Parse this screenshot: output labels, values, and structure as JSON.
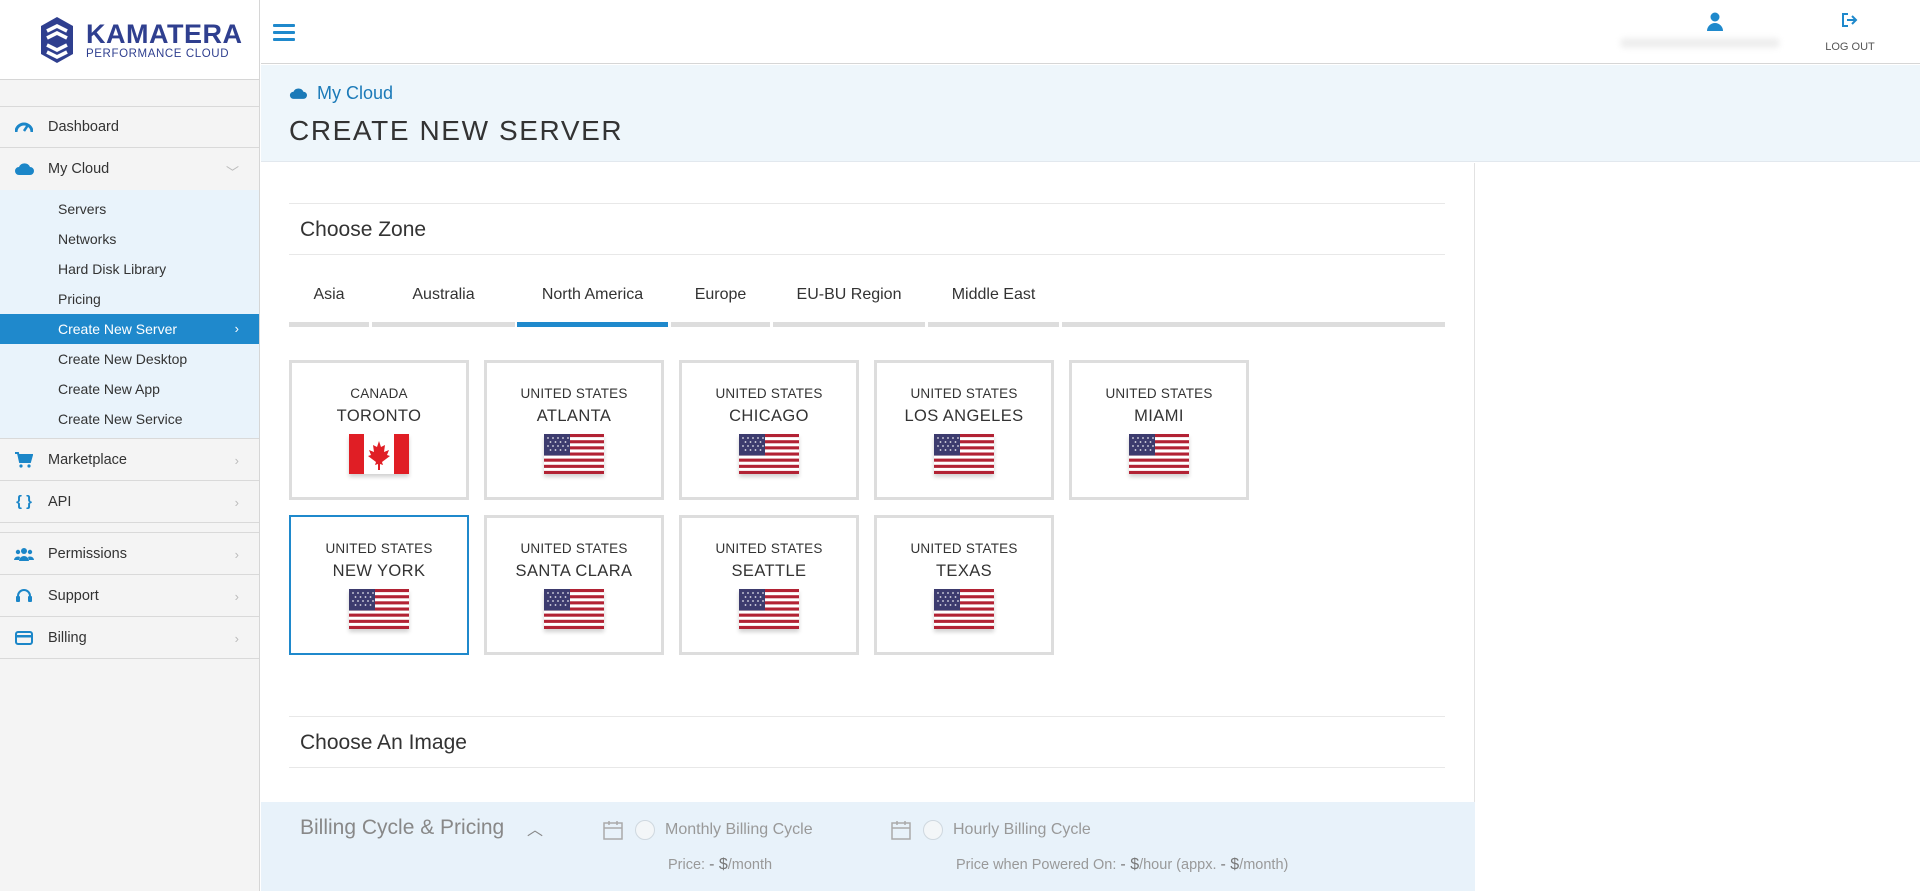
{
  "logo": {
    "brand": "KAMATERA",
    "tagline": "PERFORMANCE CLOUD"
  },
  "topbar": {
    "logout_label": "LOG OUT"
  },
  "sidebar": {
    "items": [
      {
        "label": "Dashboard",
        "icon": "dashboard-icon"
      },
      {
        "label": "My Cloud",
        "icon": "cloud-icon"
      },
      {
        "label": "Marketplace",
        "icon": "cart-icon"
      },
      {
        "label": "API",
        "icon": "braces-icon"
      },
      {
        "label": "Permissions",
        "icon": "users-icon"
      },
      {
        "label": "Support",
        "icon": "headset-icon"
      },
      {
        "label": "Billing",
        "icon": "credit-card-icon"
      }
    ],
    "my_cloud_sub": [
      "Servers",
      "Networks",
      "Hard Disk Library",
      "Pricing",
      "Create New Server",
      "Create New Desktop",
      "Create New App",
      "Create New Service"
    ],
    "active_sub": "Create New Server"
  },
  "header": {
    "breadcrumb": "My Cloud",
    "title": "CREATE NEW SERVER"
  },
  "zone_section": {
    "title": "Choose Zone",
    "tabs": [
      "Asia",
      "Australia",
      "North America",
      "Europe",
      "EU-BU Region",
      "Middle East"
    ],
    "active_tab": "North America",
    "zones": [
      {
        "country": "CANADA",
        "city": "TORONTO",
        "flag": "canada-flag-icon"
      },
      {
        "country": "UNITED STATES",
        "city": "ATLANTA",
        "flag": "us-flag-icon"
      },
      {
        "country": "UNITED STATES",
        "city": "CHICAGO",
        "flag": "us-flag-icon"
      },
      {
        "country": "UNITED STATES",
        "city": "LOS ANGELES",
        "flag": "us-flag-icon"
      },
      {
        "country": "UNITED STATES",
        "city": "MIAMI",
        "flag": "us-flag-icon"
      },
      {
        "country": "UNITED STATES",
        "city": "NEW YORK",
        "flag": "us-flag-icon"
      },
      {
        "country": "UNITED STATES",
        "city": "SANTA CLARA",
        "flag": "us-flag-icon"
      },
      {
        "country": "UNITED STATES",
        "city": "SEATTLE",
        "flag": "us-flag-icon"
      },
      {
        "country": "UNITED STATES",
        "city": "TEXAS",
        "flag": "us-flag-icon"
      }
    ],
    "selected_zone": "NEW YORK"
  },
  "image_section": {
    "title": "Choose An Image"
  },
  "billing": {
    "title": "Billing Cycle & Pricing",
    "monthly": {
      "label": "Monthly Billing Cycle",
      "price_prefix": "Price: ",
      "price_value": "- $",
      "price_suffix": "/month"
    },
    "hourly": {
      "label": "Hourly Billing Cycle",
      "price_prefix": "Price when Powered On: ",
      "price_value": "- $",
      "price_mid": "/hour (appx. ",
      "price_value2": "- $",
      "price_suffix": "/month)"
    }
  },
  "colors": {
    "accent": "#1f89cc",
    "brand": "#2f3f8f",
    "header_bg": "#eef6fb"
  }
}
